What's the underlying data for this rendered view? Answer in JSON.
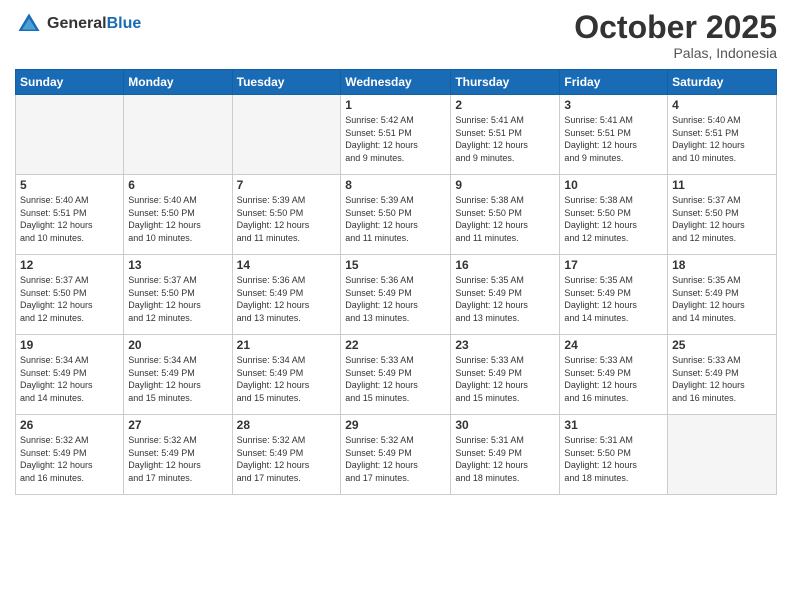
{
  "header": {
    "logo_general": "General",
    "logo_blue": "Blue",
    "month_title": "October 2025",
    "location": "Palas, Indonesia"
  },
  "weekdays": [
    "Sunday",
    "Monday",
    "Tuesday",
    "Wednesday",
    "Thursday",
    "Friday",
    "Saturday"
  ],
  "weeks": [
    [
      {
        "day": "",
        "info": ""
      },
      {
        "day": "",
        "info": ""
      },
      {
        "day": "",
        "info": ""
      },
      {
        "day": "1",
        "info": "Sunrise: 5:42 AM\nSunset: 5:51 PM\nDaylight: 12 hours\nand 9 minutes."
      },
      {
        "day": "2",
        "info": "Sunrise: 5:41 AM\nSunset: 5:51 PM\nDaylight: 12 hours\nand 9 minutes."
      },
      {
        "day": "3",
        "info": "Sunrise: 5:41 AM\nSunset: 5:51 PM\nDaylight: 12 hours\nand 9 minutes."
      },
      {
        "day": "4",
        "info": "Sunrise: 5:40 AM\nSunset: 5:51 PM\nDaylight: 12 hours\nand 10 minutes."
      }
    ],
    [
      {
        "day": "5",
        "info": "Sunrise: 5:40 AM\nSunset: 5:51 PM\nDaylight: 12 hours\nand 10 minutes."
      },
      {
        "day": "6",
        "info": "Sunrise: 5:40 AM\nSunset: 5:50 PM\nDaylight: 12 hours\nand 10 minutes."
      },
      {
        "day": "7",
        "info": "Sunrise: 5:39 AM\nSunset: 5:50 PM\nDaylight: 12 hours\nand 11 minutes."
      },
      {
        "day": "8",
        "info": "Sunrise: 5:39 AM\nSunset: 5:50 PM\nDaylight: 12 hours\nand 11 minutes."
      },
      {
        "day": "9",
        "info": "Sunrise: 5:38 AM\nSunset: 5:50 PM\nDaylight: 12 hours\nand 11 minutes."
      },
      {
        "day": "10",
        "info": "Sunrise: 5:38 AM\nSunset: 5:50 PM\nDaylight: 12 hours\nand 12 minutes."
      },
      {
        "day": "11",
        "info": "Sunrise: 5:37 AM\nSunset: 5:50 PM\nDaylight: 12 hours\nand 12 minutes."
      }
    ],
    [
      {
        "day": "12",
        "info": "Sunrise: 5:37 AM\nSunset: 5:50 PM\nDaylight: 12 hours\nand 12 minutes."
      },
      {
        "day": "13",
        "info": "Sunrise: 5:37 AM\nSunset: 5:50 PM\nDaylight: 12 hours\nand 12 minutes."
      },
      {
        "day": "14",
        "info": "Sunrise: 5:36 AM\nSunset: 5:49 PM\nDaylight: 12 hours\nand 13 minutes."
      },
      {
        "day": "15",
        "info": "Sunrise: 5:36 AM\nSunset: 5:49 PM\nDaylight: 12 hours\nand 13 minutes."
      },
      {
        "day": "16",
        "info": "Sunrise: 5:35 AM\nSunset: 5:49 PM\nDaylight: 12 hours\nand 13 minutes."
      },
      {
        "day": "17",
        "info": "Sunrise: 5:35 AM\nSunset: 5:49 PM\nDaylight: 12 hours\nand 14 minutes."
      },
      {
        "day": "18",
        "info": "Sunrise: 5:35 AM\nSunset: 5:49 PM\nDaylight: 12 hours\nand 14 minutes."
      }
    ],
    [
      {
        "day": "19",
        "info": "Sunrise: 5:34 AM\nSunset: 5:49 PM\nDaylight: 12 hours\nand 14 minutes."
      },
      {
        "day": "20",
        "info": "Sunrise: 5:34 AM\nSunset: 5:49 PM\nDaylight: 12 hours\nand 15 minutes."
      },
      {
        "day": "21",
        "info": "Sunrise: 5:34 AM\nSunset: 5:49 PM\nDaylight: 12 hours\nand 15 minutes."
      },
      {
        "day": "22",
        "info": "Sunrise: 5:33 AM\nSunset: 5:49 PM\nDaylight: 12 hours\nand 15 minutes."
      },
      {
        "day": "23",
        "info": "Sunrise: 5:33 AM\nSunset: 5:49 PM\nDaylight: 12 hours\nand 15 minutes."
      },
      {
        "day": "24",
        "info": "Sunrise: 5:33 AM\nSunset: 5:49 PM\nDaylight: 12 hours\nand 16 minutes."
      },
      {
        "day": "25",
        "info": "Sunrise: 5:33 AM\nSunset: 5:49 PM\nDaylight: 12 hours\nand 16 minutes."
      }
    ],
    [
      {
        "day": "26",
        "info": "Sunrise: 5:32 AM\nSunset: 5:49 PM\nDaylight: 12 hours\nand 16 minutes."
      },
      {
        "day": "27",
        "info": "Sunrise: 5:32 AM\nSunset: 5:49 PM\nDaylight: 12 hours\nand 17 minutes."
      },
      {
        "day": "28",
        "info": "Sunrise: 5:32 AM\nSunset: 5:49 PM\nDaylight: 12 hours\nand 17 minutes."
      },
      {
        "day": "29",
        "info": "Sunrise: 5:32 AM\nSunset: 5:49 PM\nDaylight: 12 hours\nand 17 minutes."
      },
      {
        "day": "30",
        "info": "Sunrise: 5:31 AM\nSunset: 5:49 PM\nDaylight: 12 hours\nand 18 minutes."
      },
      {
        "day": "31",
        "info": "Sunrise: 5:31 AM\nSunset: 5:50 PM\nDaylight: 12 hours\nand 18 minutes."
      },
      {
        "day": "",
        "info": ""
      }
    ]
  ]
}
